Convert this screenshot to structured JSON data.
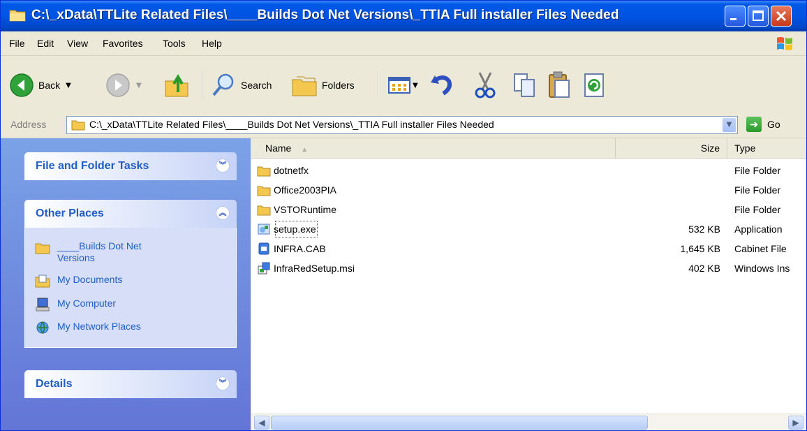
{
  "window": {
    "title": "C:\\_xData\\TTLite Related Files\\____Builds Dot Net Versions\\_TTIA Full installer Files Needed"
  },
  "menu": [
    "File",
    "Edit",
    "View",
    "Favorites",
    "Tools",
    "Help"
  ],
  "toolbar": {
    "back_label": "Back",
    "search_label": "Search",
    "folders_label": "Folders"
  },
  "address": {
    "label": "Address",
    "path": "C:\\_xData\\TTLite Related Files\\____Builds Dot Net Versions\\_TTIA Full installer Files Needed",
    "go_label": "Go"
  },
  "taskpane": {
    "file_tasks": "File and Folder Tasks",
    "other_places": "Other Places",
    "places": [
      {
        "label": "____Builds Dot Net Versions",
        "icon": "folder-icon"
      },
      {
        "label": "My Documents",
        "icon": "my-documents-icon"
      },
      {
        "label": "My Computer",
        "icon": "my-computer-icon"
      },
      {
        "label": "My Network Places",
        "icon": "network-places-icon"
      }
    ],
    "details": "Details"
  },
  "columns": {
    "name": "Name",
    "size": "Size",
    "type": "Type"
  },
  "files": [
    {
      "name": "dotnetfx",
      "size": "",
      "type": "File Folder",
      "icon": "folder-icon"
    },
    {
      "name": "Office2003PIA",
      "size": "",
      "type": "File Folder",
      "icon": "folder-icon"
    },
    {
      "name": "VSTORuntime",
      "size": "",
      "type": "File Folder",
      "icon": "folder-icon"
    },
    {
      "name": "setup.exe",
      "size": "532 KB",
      "type": "Application",
      "icon": "setup-exe-icon"
    },
    {
      "name": "INFRA.CAB",
      "size": "1,645 KB",
      "type": "Cabinet File",
      "icon": "cabinet-file-icon"
    },
    {
      "name": "InfraRedSetup.msi",
      "size": "402 KB",
      "type": "Windows Ins",
      "icon": "msi-installer-icon"
    }
  ],
  "colors": {
    "title_blue": "#0054e3",
    "task_pane_blue": "#6375d6",
    "link_blue": "#215dc6"
  }
}
